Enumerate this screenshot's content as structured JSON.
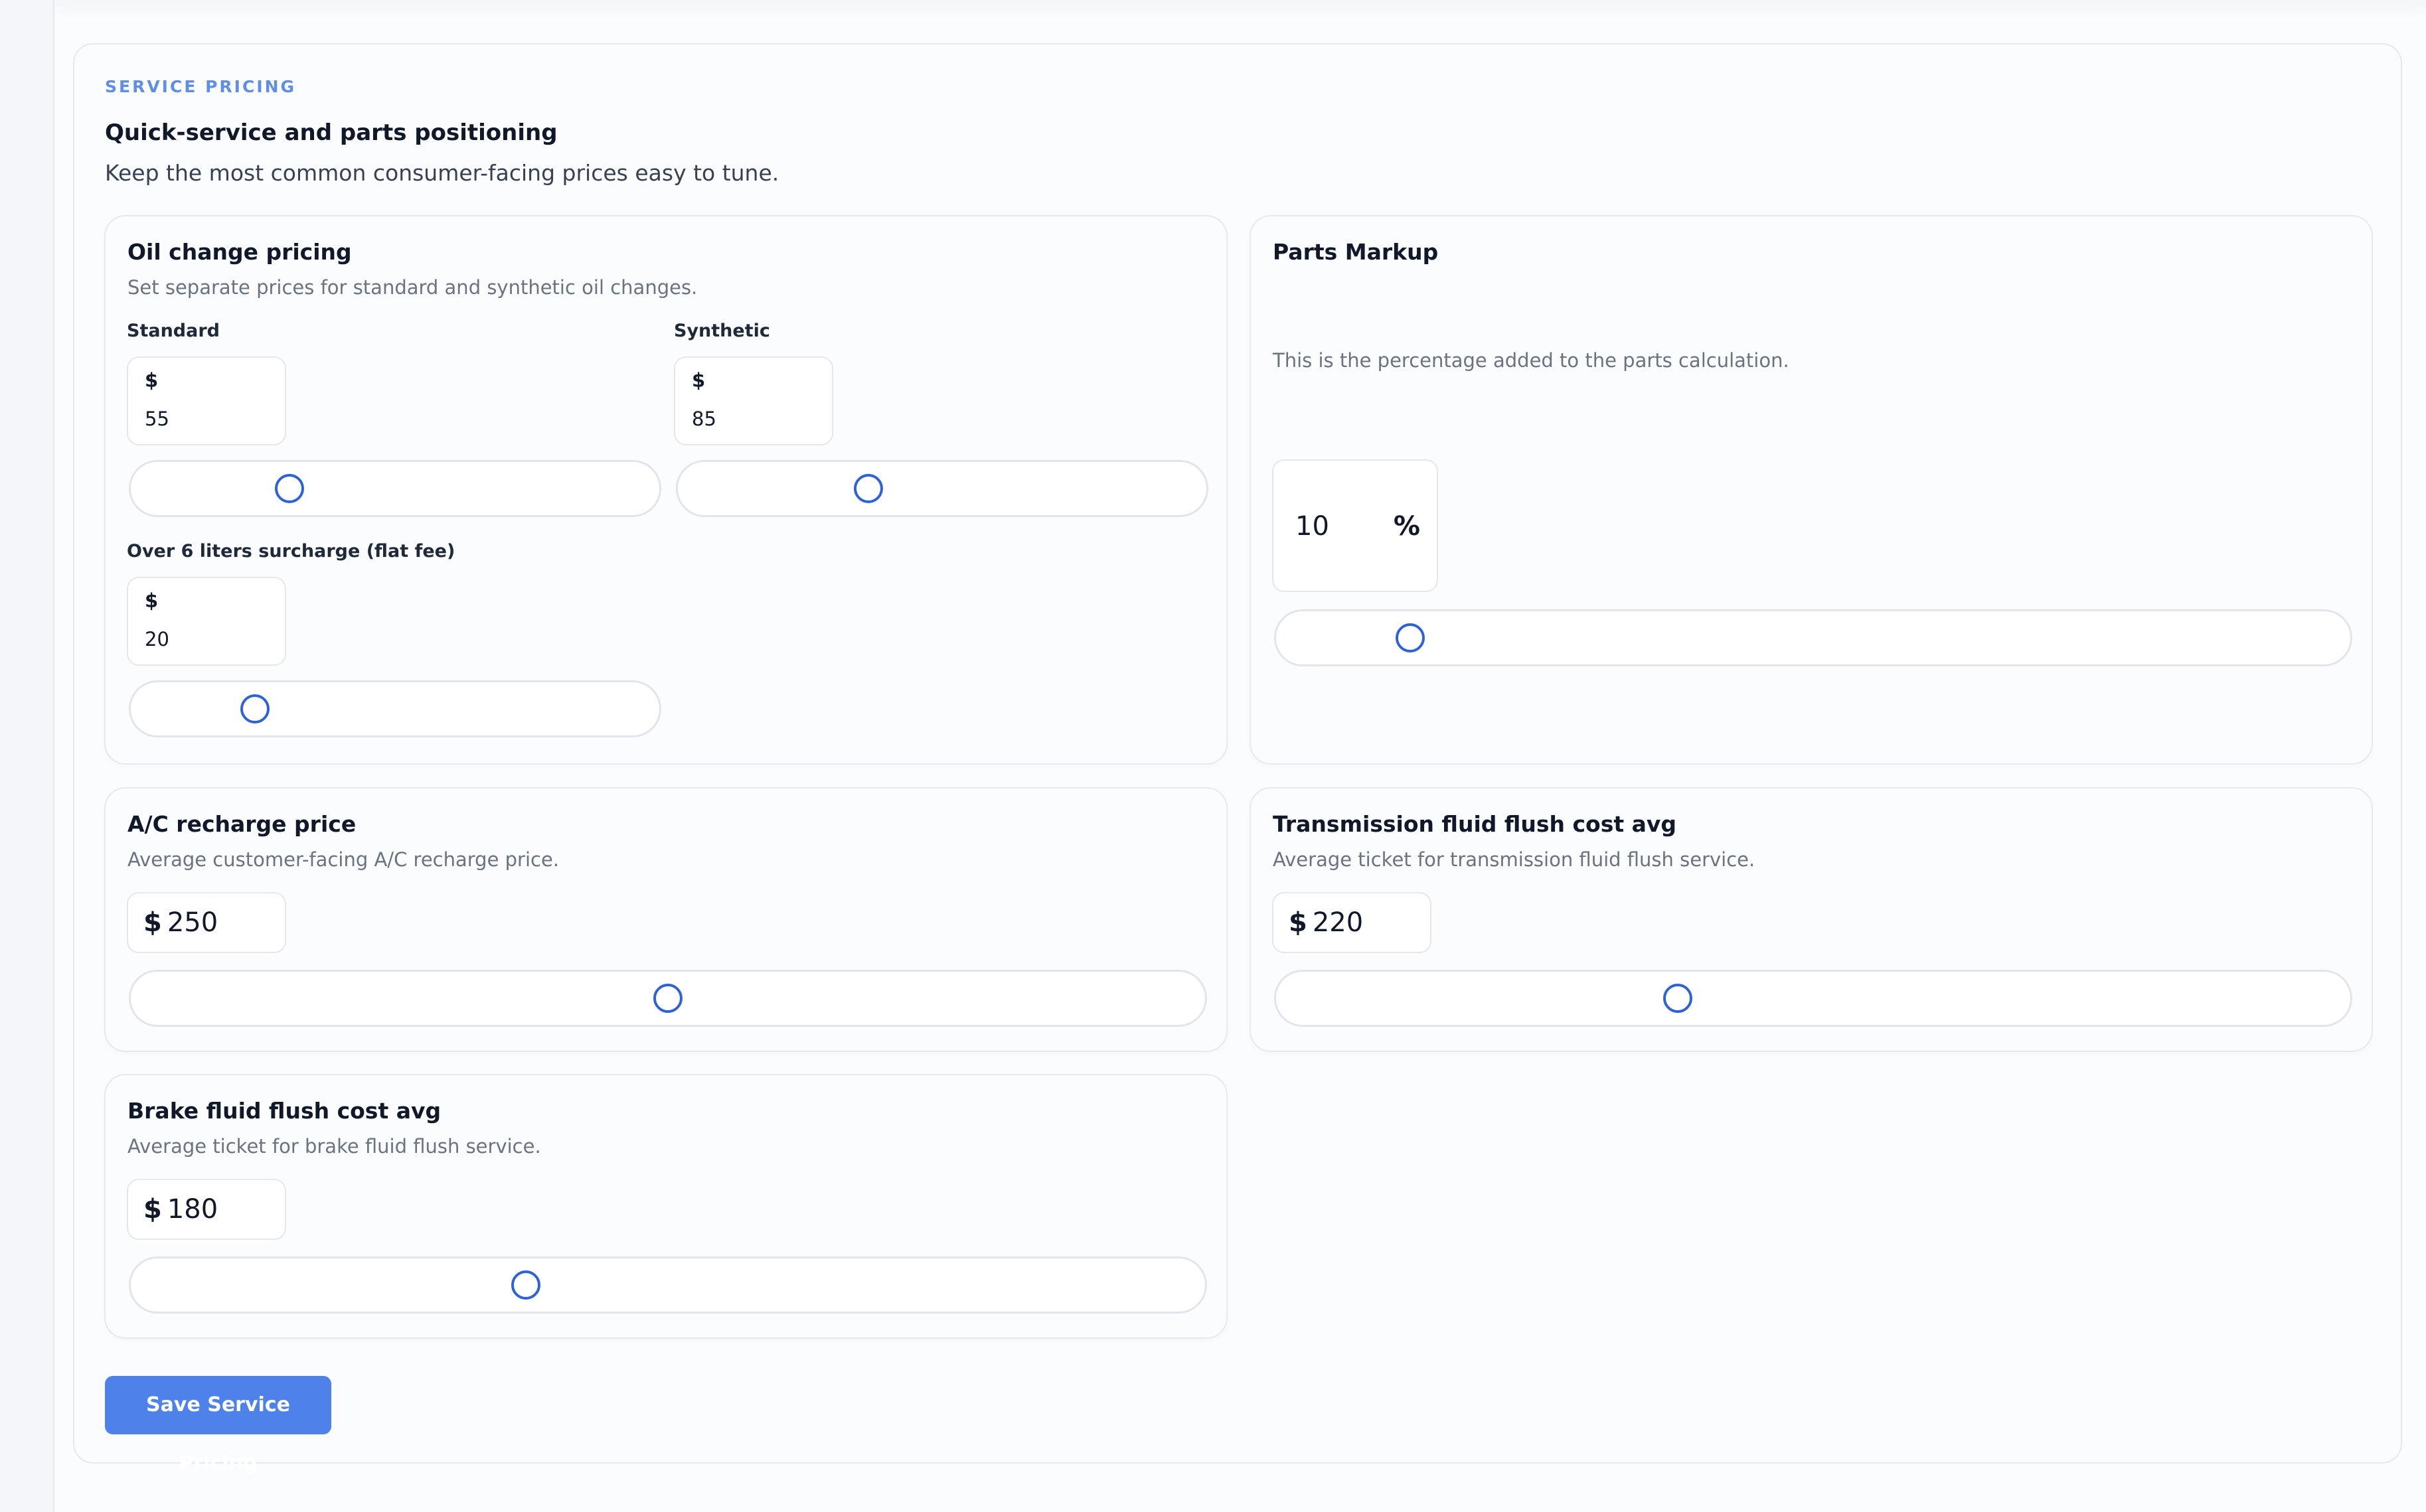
{
  "section": {
    "eyebrow": "SERVICE PRICING",
    "title": "Quick-service and parts positioning",
    "subtitle": "Keep the most common consumer-facing prices easy to tune."
  },
  "oil_change": {
    "title": "Oil change pricing",
    "description": "Set separate prices for standard and synthetic oil changes.",
    "standard": {
      "label": "Standard",
      "currency": "$",
      "value": "55",
      "slider_fraction": 0.3
    },
    "synthetic": {
      "label": "Synthetic",
      "currency": "$",
      "value": "85",
      "slider_fraction": 0.36
    },
    "surcharge": {
      "label": "Over 6 liters surcharge (flat fee)",
      "currency": "$",
      "value": "20",
      "slider_fraction": 0.235
    }
  },
  "parts_markup": {
    "title": "Parts Markup",
    "description": "This is the percentage added to the parts calculation.",
    "value": "10",
    "unit": "%",
    "slider_fraction": 0.125
  },
  "ac_recharge": {
    "title": "A/C recharge price",
    "description": "Average customer-facing A/C recharge price.",
    "currency": "$",
    "value": "250",
    "slider_fraction": 0.5
  },
  "transmission_flush": {
    "title": "Transmission fluid flush cost avg",
    "description": "Average ticket for transmission fluid flush service.",
    "currency": "$",
    "value": "220",
    "slider_fraction": 0.374
  },
  "brake_flush": {
    "title": "Brake fluid flush cost avg",
    "description": "Average ticket for brake fluid flush service.",
    "currency": "$",
    "value": "180",
    "slider_fraction": 0.368
  },
  "actions": {
    "save_label": "Save Service Pricing"
  },
  "colors": {
    "accent": "#2f63d5",
    "button": "#4f81ea",
    "eyebrow": "#5f8ee6"
  }
}
